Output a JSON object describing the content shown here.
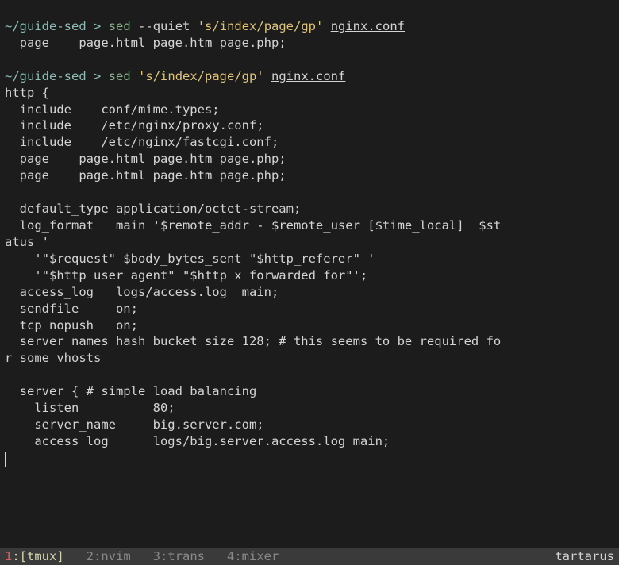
{
  "prompt1": {
    "path": "~/guide-sed",
    "sep": ">",
    "cmd": "sed",
    "flag": "--quiet",
    "string": "'s/index/page/gp'",
    "arg": "nginx.conf"
  },
  "out1": {
    "l1": "  page    page.html page.htm page.php;"
  },
  "prompt2": {
    "path": "~/guide-sed",
    "sep": ">",
    "cmd": "sed",
    "string": "'s/index/page/gp'",
    "arg": "nginx.conf"
  },
  "out2": {
    "l01": "http {",
    "l02": "  include    conf/mime.types;",
    "l03": "  include    /etc/nginx/proxy.conf;",
    "l04": "  include    /etc/nginx/fastcgi.conf;",
    "l05": "  page    page.html page.htm page.php;",
    "l06": "  page    page.html page.htm page.php;",
    "l07": "",
    "l08": "  default_type application/octet-stream;",
    "l09": "  log_format   main '$remote_addr - $remote_user [$time_local]  $st",
    "l10": "atus '",
    "l11": "    '\"$request\" $body_bytes_sent \"$http_referer\" '",
    "l12": "    '\"$http_user_agent\" \"$http_x_forwarded_for\"';",
    "l13": "  access_log   logs/access.log  main;",
    "l14": "  sendfile     on;",
    "l15": "  tcp_nopush   on;",
    "l16": "  server_names_hash_bucket_size 128; # this seems to be required fo",
    "l17": "r some vhosts",
    "l18": "",
    "l19": "  server { # simple load balancing",
    "l20": "    listen          80;",
    "l21": "    server_name     big.server.com;",
    "l22": "    access_log      logs/big.server.access.log main;"
  },
  "status": {
    "win1num": "1",
    "win1name": ":[tmux]",
    "win2": "2:nvim",
    "win3": "3:trans",
    "win4": "4:mixer",
    "host": "tartarus"
  }
}
